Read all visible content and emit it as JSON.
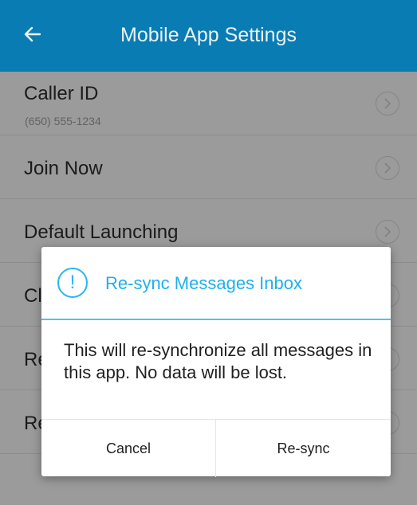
{
  "app_bar": {
    "title": "Mobile App Settings",
    "back_icon": "arrow-left-icon"
  },
  "settings": {
    "items": [
      {
        "label": "Caller ID",
        "sublabel": "(650) 555-1234"
      },
      {
        "label": "Join Now"
      },
      {
        "label": "Default Launching"
      },
      {
        "label": "Cl"
      },
      {
        "label": "Re"
      },
      {
        "label": "Re"
      }
    ],
    "chevron_icon": "chevron-right-icon"
  },
  "dialog": {
    "icon": "alert-circle-icon",
    "title": "Re-sync Messages Inbox",
    "body": "This will re-synchronize all messages in this app. No data will be lost.",
    "cancel_label": "Cancel",
    "confirm_label": "Re-sync"
  },
  "colors": {
    "app_bar": "#0a7cb4",
    "accent": "#29b6ef",
    "scrim": "rgba(0,0,0,0.36)"
  }
}
